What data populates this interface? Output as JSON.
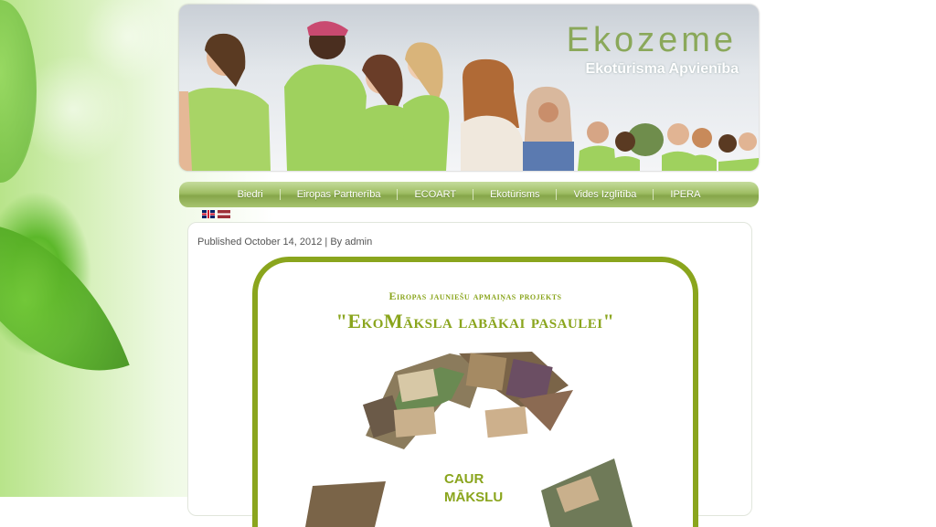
{
  "header": {
    "site_title": "Ekozeme",
    "site_subtitle": "Ekotūrisma Apvienība"
  },
  "nav": {
    "items": [
      {
        "label": "Biedri"
      },
      {
        "label": "Eiropas Partnerība"
      },
      {
        "label": "ECOART"
      },
      {
        "label": "Ekotūrisms"
      },
      {
        "label": "Vides Izglītība"
      },
      {
        "label": "IPERA"
      }
    ]
  },
  "languages": [
    {
      "icon": "uk-flag-icon"
    },
    {
      "icon": "latvia-flag-icon"
    }
  ],
  "post": {
    "meta": "Published October 14, 2012 | By admin"
  },
  "poster": {
    "line1": "Eiropas jauniešu apmaiņas  projekts",
    "line2": "\"EkoMāksla labākai pasaulei\"",
    "caur_line1": "CAUR",
    "caur_line2": "MĀKSLU"
  },
  "colors": {
    "accent": "#8aa51d",
    "nav_green": "#9ebd63",
    "title_green": "#8aa85a"
  }
}
